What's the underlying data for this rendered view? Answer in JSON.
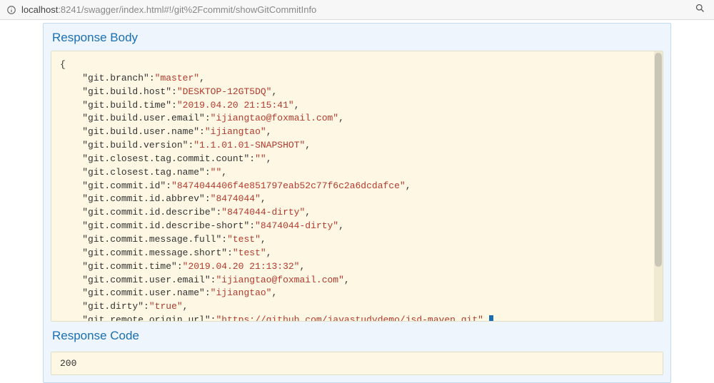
{
  "url": {
    "host": "localhost",
    "rest": ":8241/swagger/index.html#!/git%2Fcommit/showGitCommitInfo"
  },
  "sections": {
    "responseBodyTitle": "Response Body",
    "responseCodeTitle": "Response Code"
  },
  "responseCode": "200",
  "jsonLines": [
    {
      "prefix": "{",
      "key": null,
      "value": null,
      "suffix": ""
    },
    {
      "prefix": "    ",
      "key": "\"git.branch\"",
      "value": "\"master\"",
      "suffix": ","
    },
    {
      "prefix": "    ",
      "key": "\"git.build.host\"",
      "value": "\"DESKTOP-12GT5DQ\"",
      "suffix": ","
    },
    {
      "prefix": "    ",
      "key": "\"git.build.time\"",
      "value": "\"2019.04.20 21:15:41\"",
      "suffix": ","
    },
    {
      "prefix": "    ",
      "key": "\"git.build.user.email\"",
      "value": "\"ijiangtao@foxmail.com\"",
      "suffix": ","
    },
    {
      "prefix": "    ",
      "key": "\"git.build.user.name\"",
      "value": "\"ijiangtao\"",
      "suffix": ","
    },
    {
      "prefix": "    ",
      "key": "\"git.build.version\"",
      "value": "\"1.1.01.01-SNAPSHOT\"",
      "suffix": ","
    },
    {
      "prefix": "    ",
      "key": "\"git.closest.tag.commit.count\"",
      "value": "\"\"",
      "suffix": ","
    },
    {
      "prefix": "    ",
      "key": "\"git.closest.tag.name\"",
      "value": "\"\"",
      "suffix": ","
    },
    {
      "prefix": "    ",
      "key": "\"git.commit.id\"",
      "value": "\"8474044406f4e851797eab52c77f6c2a6dcdafce\"",
      "suffix": ","
    },
    {
      "prefix": "    ",
      "key": "\"git.commit.id.abbrev\"",
      "value": "\"8474044\"",
      "suffix": ","
    },
    {
      "prefix": "    ",
      "key": "\"git.commit.id.describe\"",
      "value": "\"8474044-dirty\"",
      "suffix": ","
    },
    {
      "prefix": "    ",
      "key": "\"git.commit.id.describe-short\"",
      "value": "\"8474044-dirty\"",
      "suffix": ","
    },
    {
      "prefix": "    ",
      "key": "\"git.commit.message.full\"",
      "value": "\"test\"",
      "suffix": ","
    },
    {
      "prefix": "    ",
      "key": "\"git.commit.message.short\"",
      "value": "\"test\"",
      "suffix": ","
    },
    {
      "prefix": "    ",
      "key": "\"git.commit.time\"",
      "value": "\"2019.04.20 21:13:32\"",
      "suffix": ","
    },
    {
      "prefix": "    ",
      "key": "\"git.commit.user.email\"",
      "value": "\"ijiangtao@foxmail.com\"",
      "suffix": ","
    },
    {
      "prefix": "    ",
      "key": "\"git.commit.user.name\"",
      "value": "\"ijiangtao\"",
      "suffix": ","
    },
    {
      "prefix": "    ",
      "key": "\"git.dirty\"",
      "value": "\"true\"",
      "suffix": ","
    },
    {
      "prefix": "    ",
      "key": "\"git.remote.origin.url\"",
      "value": "\"https://github.com/javastudydemo/jsd-maven.git\"",
      "suffix": ",",
      "cursor": true
    }
  ]
}
